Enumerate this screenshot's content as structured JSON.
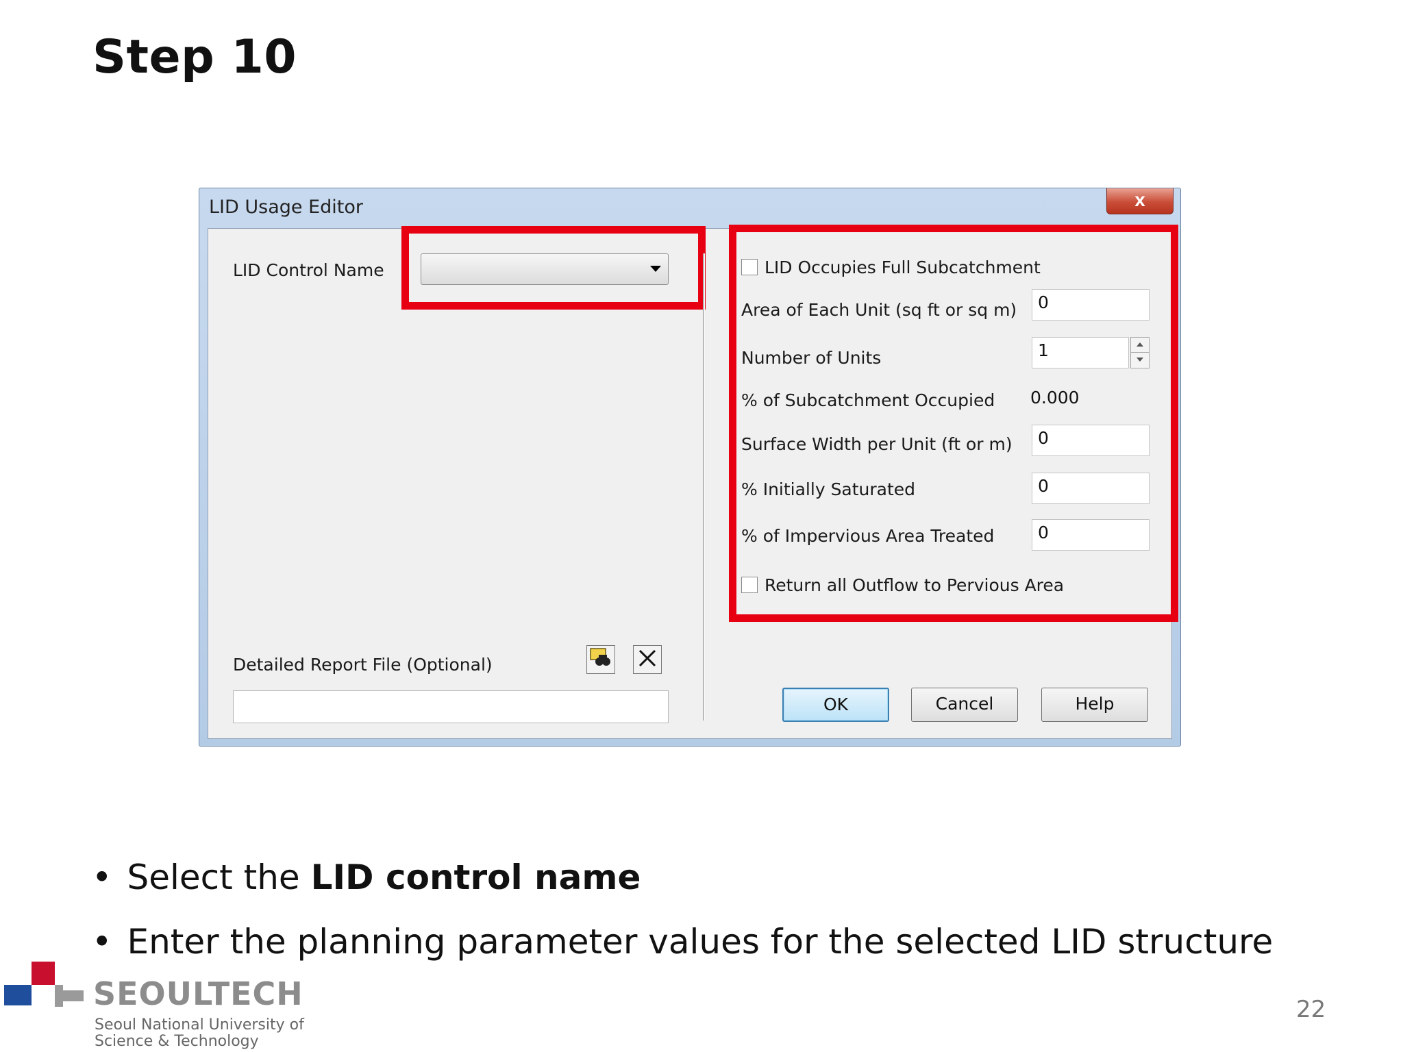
{
  "slide": {
    "title": "Step 10",
    "page_number": "22"
  },
  "dialog": {
    "title": "LID Usage Editor",
    "close_label": "x",
    "lid_control_name_label": "LID Control Name",
    "lid_control_name_value": "",
    "full_subcatchment_label": "LID Occupies Full Subcatchment",
    "full_subcatchment_checked": false,
    "area_label": "Area of Each Unit (sq ft or sq m)",
    "area_value": "0",
    "units_label": "Number of Units",
    "units_value": "1",
    "pct_occupied_label": "% of Subcatchment Occupied",
    "pct_occupied_value": "0.000",
    "width_label": "Surface Width per Unit (ft or m)",
    "width_value": "0",
    "saturated_label": "% Initially Saturated",
    "saturated_value": "0",
    "impervious_label": "% of Impervious Area Treated",
    "impervious_value": "0",
    "return_outflow_label": "Return all Outflow to Pervious Area",
    "return_outflow_checked": false,
    "report_file_label": "Detailed Report File (Optional)",
    "report_file_value": "",
    "ok_label": "OK",
    "cancel_label": "Cancel",
    "help_label": "Help"
  },
  "bullets": {
    "b1_prefix": "Select the ",
    "b1_bold": "LID control name",
    "b2": "Enter the planning parameter values for the selected LID structure"
  },
  "logo": {
    "name": "SEOULTECH",
    "line1": "Seoul National University of",
    "line2": "Science & Technology"
  },
  "colors": {
    "highlight": "#e60012",
    "dialog_frame": "#b4cbe6",
    "logo_red": "#c8102e",
    "logo_blue": "#1f4e9c"
  }
}
